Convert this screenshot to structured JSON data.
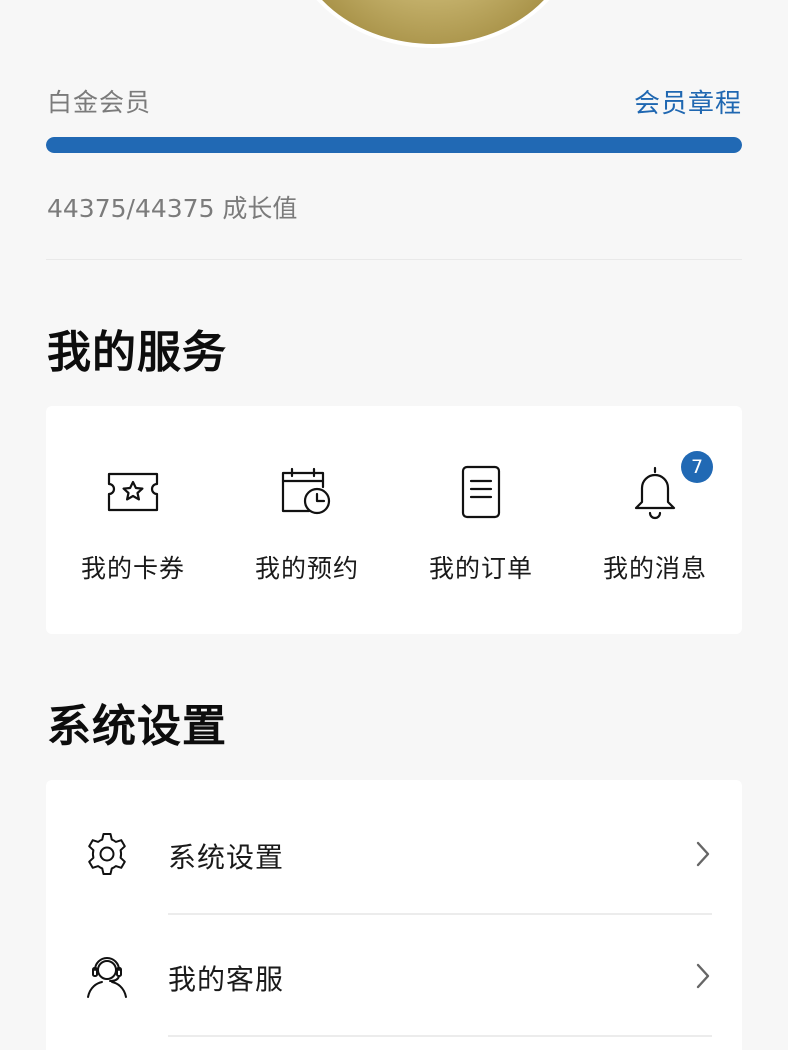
{
  "member": {
    "level": "白金会员",
    "rules_link": "会员章程",
    "progress_fraction": 1.0,
    "growth_text": "44375/44375 成长值"
  },
  "services": {
    "title": "我的服务",
    "items": [
      {
        "label": "我的卡券",
        "icon": "ticket-star-icon"
      },
      {
        "label": "我的预约",
        "icon": "calendar-clock-icon"
      },
      {
        "label": "我的订单",
        "icon": "document-list-icon"
      },
      {
        "label": "我的消息",
        "icon": "bell-icon",
        "badge": "7"
      }
    ]
  },
  "settings": {
    "title": "系统设置",
    "items": [
      {
        "label": "系统设置",
        "icon": "gear-icon"
      },
      {
        "label": "我的客服",
        "icon": "headset-agent-icon"
      }
    ]
  },
  "colors": {
    "accent": "#2169b4",
    "link": "#1f67b1",
    "muted_text": "#7b7b7b"
  }
}
